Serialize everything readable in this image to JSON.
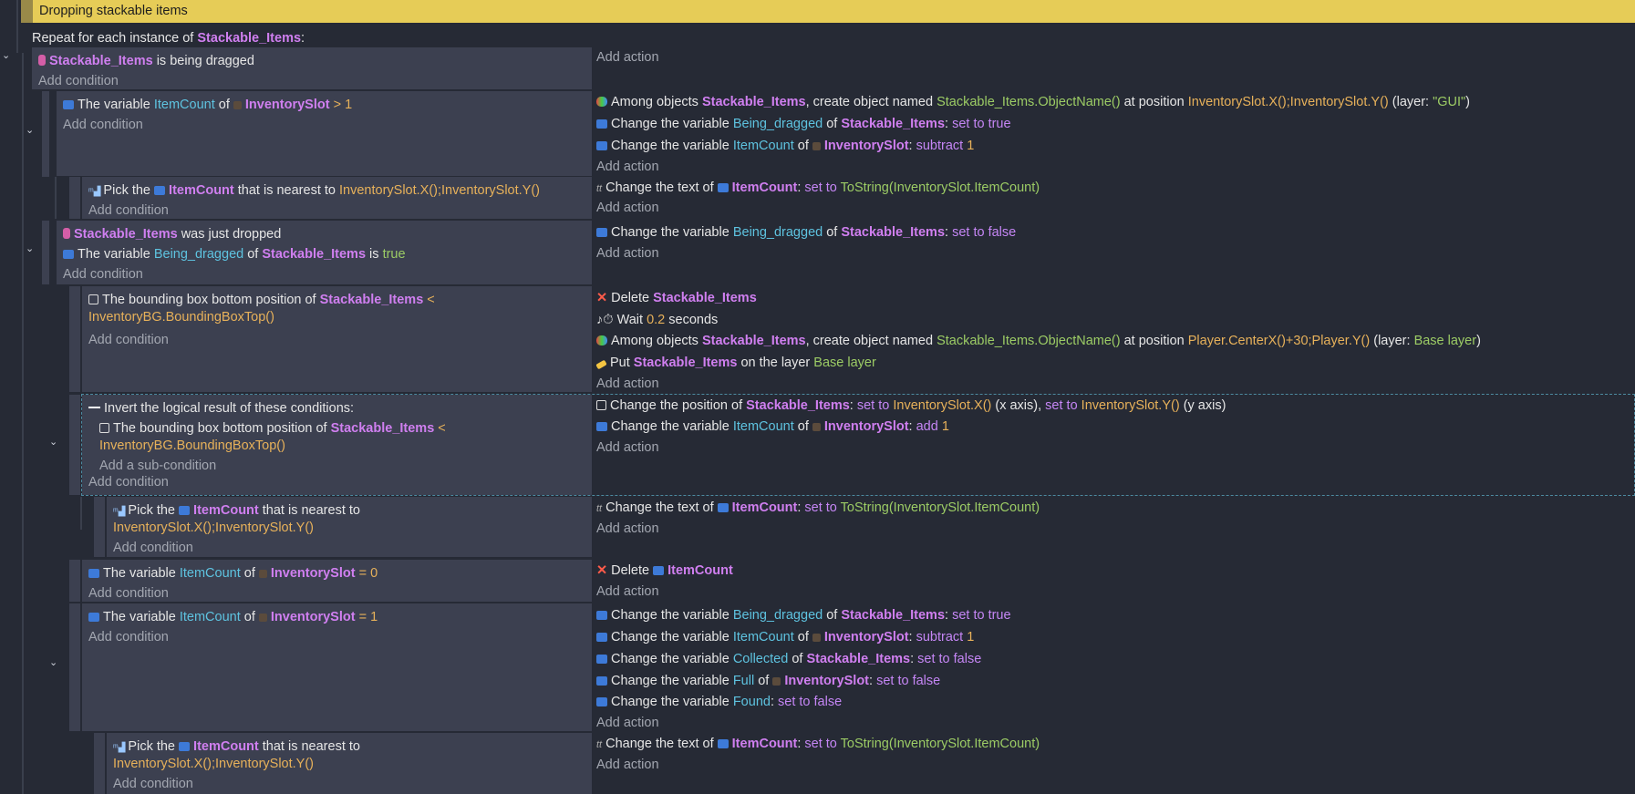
{
  "comment": "Dropping stackable items",
  "repeat": {
    "prefix": "Repeat for each instance of",
    "object": "Stackable_Items",
    "suffix": ":"
  },
  "common": {
    "add_condition": "Add condition",
    "add_action": "Add action",
    "add_subcondition": "Add a sub-condition",
    "the_variable": "The variable",
    "of": "of",
    "change_the_variable": "Change the variable",
    "change_text_of": "Change the text of",
    "set_to": "set to",
    "pick_the": "Pick the",
    "nearest_to": "that is nearest to"
  },
  "e1": {
    "cond_obj": "Stackable_Items",
    "cond_text": "is being dragged"
  },
  "e2": {
    "var": "ItemCount",
    "obj": "InventorySlot",
    "op": "> 1",
    "a1_pre": "Among objects",
    "a1_obj": "Stackable_Items",
    "a1_mid": ", create object named",
    "a1_expr": "Stackable_Items.ObjectName()",
    "a1_at": "at position",
    "a1_pos": "InventorySlot.X();InventorySlot.Y()",
    "a1_layer_pre": "(layer:",
    "a1_layer": "\"GUI\"",
    "a1_layer_post": ")",
    "a2_var": "Being_dragged",
    "a2_obj": "Stackable_Items",
    "a2_val": "set to true",
    "a3_var": "ItemCount",
    "a3_obj": "InventorySlot",
    "a3_op": "subtract",
    "a3_val": "1"
  },
  "e3": {
    "obj": "ItemCount",
    "pos": "InventorySlot.X();InventorySlot.Y()",
    "a_obj": "ItemCount",
    "a_set": "set to",
    "a_val": "ToString(InventorySlot.ItemCount)"
  },
  "e4": {
    "c1_obj": "Stackable_Items",
    "c1_text": "was just dropped",
    "c2_var": "Being_dragged",
    "c2_obj": "Stackable_Items",
    "c2_is": "is",
    "c2_val": "true",
    "a_var": "Being_dragged",
    "a_obj": "Stackable_Items",
    "a_val": "set to false"
  },
  "e5": {
    "c_text": "The bounding box bottom position of",
    "c_obj": "Stackable_Items",
    "c_op": "<",
    "c_expr": "InventoryBG.BoundingBoxTop()",
    "a1_pre": "Delete",
    "a1_obj": "Stackable_Items",
    "a2_pre": "Wait",
    "a2_val": "0.2",
    "a2_post": "seconds",
    "a3_pre": "Among objects",
    "a3_obj": "Stackable_Items",
    "a3_mid": ", create object named",
    "a3_expr": "Stackable_Items.ObjectName()",
    "a3_at": "at position",
    "a3_pos": "Player.CenterX()+30;Player.Y()",
    "a3_layer_pre": "(layer:",
    "a3_layer": "Base layer",
    "a3_layer_post": ")",
    "a4_pre": "Put",
    "a4_obj": "Stackable_Items",
    "a4_mid": "on the layer",
    "a4_layer": "Base layer"
  },
  "e6": {
    "inv_text": "Invert the logical result of these conditions:",
    "c_text": "The bounding box bottom position of",
    "c_obj": "Stackable_Items",
    "c_op": "<",
    "c_expr": "InventoryBG.BoundingBoxTop()",
    "a1_pre": "Change the position of",
    "a1_obj": "Stackable_Items",
    "a1_set": "set to",
    "a1_x": "InventorySlot.X()",
    "a1_xl": "(x axis),",
    "a1_set2": "set to",
    "a1_y": "InventorySlot.Y()",
    "a1_yl": "(y axis)",
    "a2_var": "ItemCount",
    "a2_obj": "InventorySlot",
    "a2_op": "add",
    "a2_val": "1"
  },
  "e7": {
    "obj": "ItemCount",
    "pos": "InventorySlot.X();InventorySlot.Y()",
    "a_obj": "ItemCount",
    "a_set": "set to",
    "a_val": "ToString(InventorySlot.ItemCount)"
  },
  "e8": {
    "var": "ItemCount",
    "obj": "InventorySlot",
    "op": "= 0",
    "a_pre": "Delete",
    "a_obj": "ItemCount"
  },
  "e9": {
    "var": "ItemCount",
    "obj": "InventorySlot",
    "op": "= 1",
    "a1_var": "Being_dragged",
    "a1_obj": "Stackable_Items",
    "a1_val": "set to true",
    "a2_var": "ItemCount",
    "a2_obj": "InventorySlot",
    "a2_op": "subtract",
    "a2_val": "1",
    "a3_var": "Collected",
    "a3_obj": "Stackable_Items",
    "a3_val": "set to false",
    "a4_var": "Full",
    "a4_obj": "InventorySlot",
    "a4_val": "set to false",
    "a5_var": "Found",
    "a5_val": "set to false"
  },
  "e10": {
    "obj": "ItemCount",
    "pos": "InventorySlot.X();InventorySlot.Y()",
    "a_obj": "ItemCount",
    "a_set": "set to",
    "a_val": "ToString(InventorySlot.ItemCount)"
  },
  "icons": {
    "collapse": "chevron-down-icon",
    "variable": "variable-icon",
    "object": "object-icon",
    "delete": "delete-icon",
    "text": "text-icon",
    "wait": "wait-icon",
    "layer": "layer-icon",
    "create": "create-object-icon",
    "pick": "pick-nearest-icon",
    "invert": "invert-icon",
    "position": "position-icon"
  }
}
